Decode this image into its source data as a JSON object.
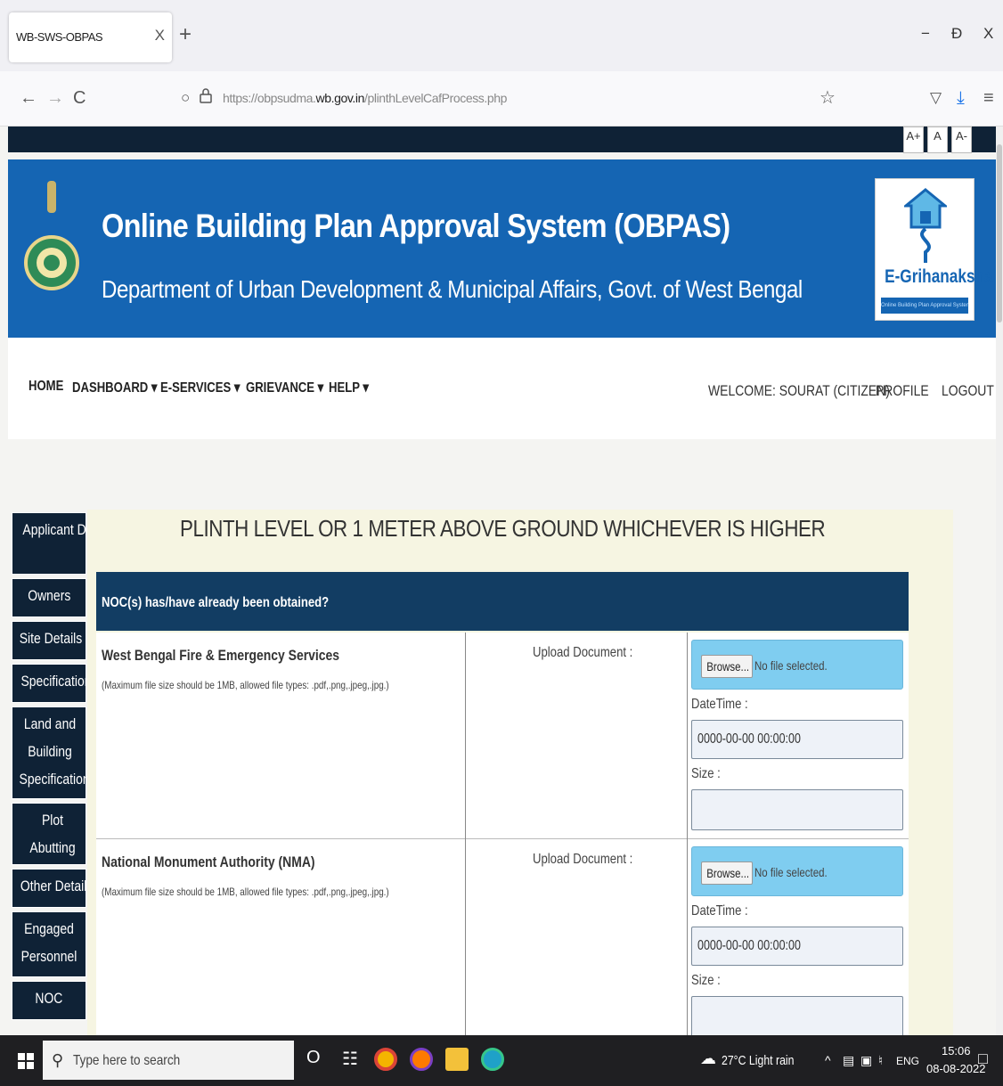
{
  "browser": {
    "tab_title": "WB-SWS-OBPAS",
    "tab_close": "X",
    "new_tab": "+",
    "url_prefix": "https://obpsudma.",
    "url_domain": "wb.gov.in",
    "url_path": "/plinthLevelCafProcess.php",
    "back": "←",
    "forward": "→",
    "reload": "C",
    "star": "☆",
    "pocket": "▽",
    "download": "⤓",
    "menu": "≡",
    "minimize": "−",
    "restore": "Ɖ",
    "close": "X",
    "shield": "○"
  },
  "accessibility": {
    "increase": "A+",
    "normal": "A",
    "decrease": "A-"
  },
  "header": {
    "title": "Online Building Plan Approval System (OBPAS)",
    "subtitle": "Department of Urban Development & Municipal Affairs, Govt. of West Bengal",
    "logo_text": "E-Grihanaksha",
    "logo_tagline": "Online Building Plan Approval System"
  },
  "menu": {
    "home": "HOME",
    "dashboard": "DASHBOARD ▾",
    "eservices": "E-SERVICES ▾",
    "grievance": "GRIEVANCE ▾",
    "help": "HELP ▾",
    "welcome": "WELCOME: SOURAT (CITIZEN)",
    "profile": "PROFILE",
    "logout": "LOGOUT"
  },
  "sidebar": {
    "items": [
      {
        "label": "Applicant Details"
      },
      {
        "label": "Owners"
      },
      {
        "label": "Site Details"
      },
      {
        "label": "Specifications"
      },
      {
        "label": "Land and Building Specifications"
      },
      {
        "label": "Plot Abutting Details"
      },
      {
        "label": "Other Details"
      },
      {
        "label": "Engaged Personnel"
      },
      {
        "label": "NOC"
      }
    ]
  },
  "content": {
    "title": "PLINTH LEVEL OR 1 METER ABOVE GROUND WHICHEVER IS HIGHER",
    "noc_question": "NOC(s) has/have already been obtained?",
    "rows": [
      {
        "name": "West Bengal Fire & Emergency Services",
        "note": "(Maximum file size should be 1MB, allowed file types: .pdf,.png,.jpeg,.jpg.)",
        "upload_label": "Upload Document :",
        "browse": "Browse...",
        "file_status": "No file selected.",
        "datetime_label": "DateTime :",
        "datetime_value": "0000-00-00 00:00:00",
        "size_label": "Size :"
      },
      {
        "name": "National Monument Authority (NMA)",
        "note": "(Maximum file size should be 1MB, allowed file types: .pdf,.png,.jpeg,.jpg.)",
        "upload_label": "Upload Document :",
        "browse": "Browse...",
        "file_status": "No file selected.",
        "datetime_label": "DateTime :",
        "datetime_value": "0000-00-00 00:00:00",
        "size_label": "Size :"
      }
    ]
  },
  "taskbar": {
    "search_placeholder": "Type here to search",
    "cortana": "O",
    "taskview": "☷",
    "weather": "27°C  Light rain",
    "tray_up": "^",
    "lang": "ENG",
    "time": "15:06",
    "date": "08-08-2022",
    "colors": {
      "chrome": "#f4b400",
      "firefox": "#ff7a00",
      "files": "#f3c13a",
      "edge": "#1fa1c8"
    }
  }
}
